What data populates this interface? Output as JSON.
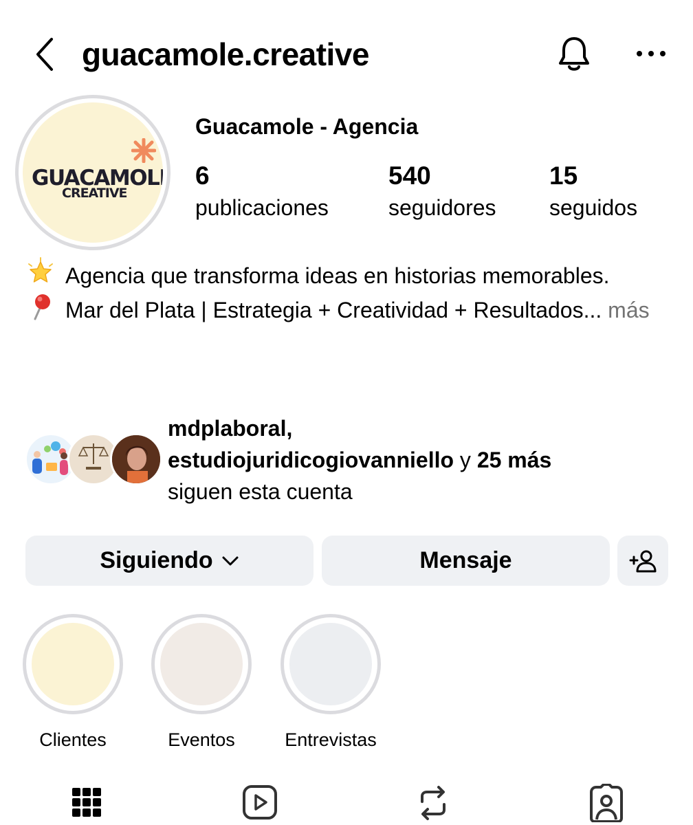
{
  "header": {
    "username": "guacamole.creative",
    "icons": {
      "back": "back-chevron-icon",
      "notifications": "bell-icon",
      "more": "more-dots-icon"
    }
  },
  "profile": {
    "display_name": "Guacamole - Agencia",
    "avatar_logo": {
      "line1": "GUACAMOLE",
      "line2": "CREATIVE"
    },
    "stats": [
      {
        "value": "6",
        "label": "publicaciones"
      },
      {
        "value": "540",
        "label": "seguidores"
      },
      {
        "value": "15",
        "label": "seguidos"
      }
    ]
  },
  "bio": {
    "line1": "Agencia que transforma ideas en historias memorables.",
    "line2": "Mar del Plata | Estrategia + Creatividad + Resultados",
    "ellipsis": "...",
    "more": "más",
    "icons": [
      "glowing-star-icon",
      "pin-icon"
    ]
  },
  "followed_by": {
    "user1": "mdplaboral",
    "comma": ",",
    "user2": "estudiojuridicogiovanniello",
    "connector": " y ",
    "others": "25 más",
    "suffix": "siguen esta cuenta"
  },
  "actions": {
    "following_label": "Siguiendo",
    "message_label": "Mensaje"
  },
  "highlights": [
    {
      "label": "Clientes",
      "color": "#fbf3d4"
    },
    {
      "label": "Eventos",
      "color": "#f1ebe6"
    },
    {
      "label": "Entrevistas",
      "color": "#eceef1"
    }
  ],
  "tabs": [
    "grid-icon",
    "reels-icon",
    "reposts-icon",
    "tagged-icon"
  ],
  "colors": {
    "button_bg": "#eff1f4",
    "muted_text": "#737373",
    "ring": "#dcdcdf"
  }
}
